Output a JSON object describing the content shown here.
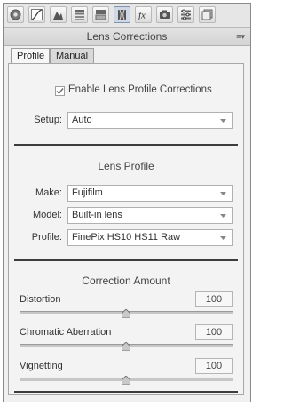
{
  "panel": {
    "title": "Lens Corrections"
  },
  "toolbar": {
    "tools": [
      {
        "icon": "basic-aperture-icon"
      },
      {
        "icon": "tone-curve-icon"
      },
      {
        "icon": "detail-icon"
      },
      {
        "icon": "hsl-icon"
      },
      {
        "icon": "split-toning-icon"
      },
      {
        "icon": "lens-corrections-icon"
      },
      {
        "icon": "effects-fx-icon"
      },
      {
        "icon": "camera-calibration-icon"
      },
      {
        "icon": "presets-icon"
      },
      {
        "icon": "snapshots-icon"
      }
    ]
  },
  "tabs": [
    {
      "label": "Profile",
      "active": true
    },
    {
      "label": "Manual",
      "active": false
    }
  ],
  "profile": {
    "enable_label": "Enable Lens Profile Corrections",
    "enable_checked": true,
    "setup_label": "Setup:",
    "setup_value": "Auto",
    "lens_profile_title": "Lens Profile",
    "make_label": "Make:",
    "make_value": "Fujifilm",
    "model_label": "Model:",
    "model_value": "Built-in lens",
    "profile_label": "Profile:",
    "profile_value": "FinePix HS10 HS11 Raw",
    "correction_title": "Correction Amount",
    "sliders": [
      {
        "label": "Distortion",
        "value": "100",
        "level": 0.5
      },
      {
        "label": "Chromatic Aberration",
        "value": "100",
        "level": 0.5
      },
      {
        "label": "Vignetting",
        "value": "100",
        "level": 0.5
      }
    ]
  },
  "colors": {
    "panel_bg": "#f0f0f0",
    "divider": "#3c3c3c",
    "active_tool": "#cfd8e4"
  }
}
